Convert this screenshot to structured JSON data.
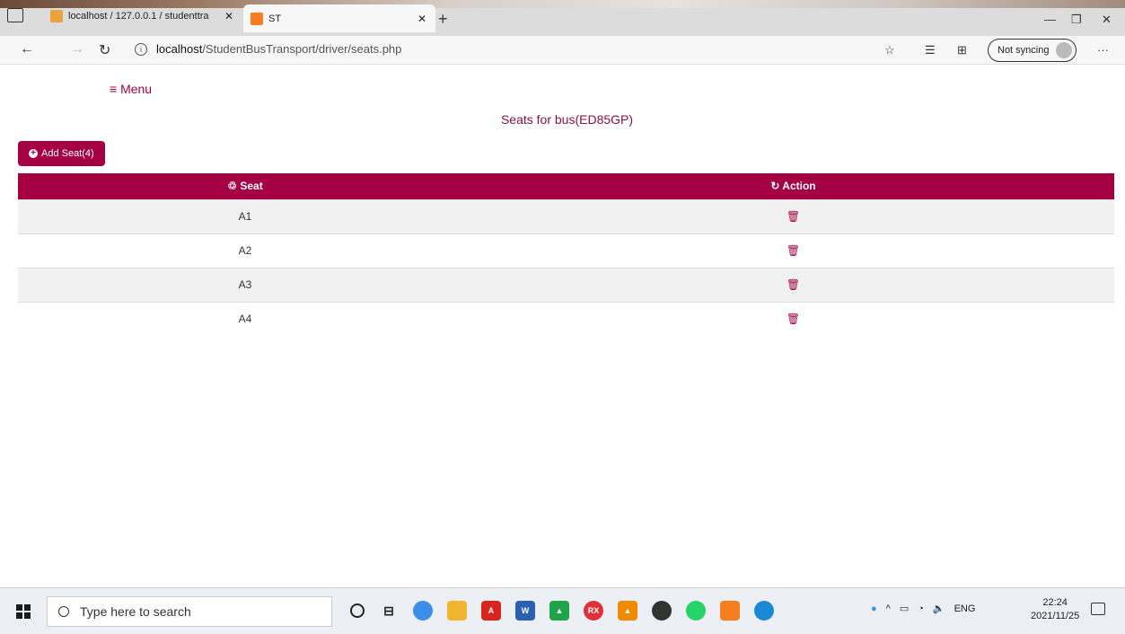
{
  "browser": {
    "tabs": [
      {
        "title": "localhost / 127.0.0.1 / studenttra",
        "close": "✕"
      },
      {
        "title": "ST",
        "close": "✕"
      }
    ],
    "new_tab": "+",
    "url_host": "localhost",
    "url_path": "/StudentBusTransport/driver/seats.php",
    "sync_label": "Not syncing",
    "more": "···"
  },
  "page": {
    "menu_label": "Menu",
    "heading": "Seats for bus(ED85GP)",
    "add_button": "Add Seat(4)",
    "table": {
      "headers": [
        "Seat",
        "Action"
      ],
      "rows": [
        {
          "seat": "A1"
        },
        {
          "seat": "A2"
        },
        {
          "seat": "A3"
        },
        {
          "seat": "A4"
        }
      ]
    }
  },
  "taskbar": {
    "search_placeholder": "Type here to search",
    "tray_lang": "ENG",
    "time": "22:24",
    "date": "2021/11/25"
  },
  "colors": {
    "accent": "#a50044",
    "heading": "#8b1140"
  }
}
